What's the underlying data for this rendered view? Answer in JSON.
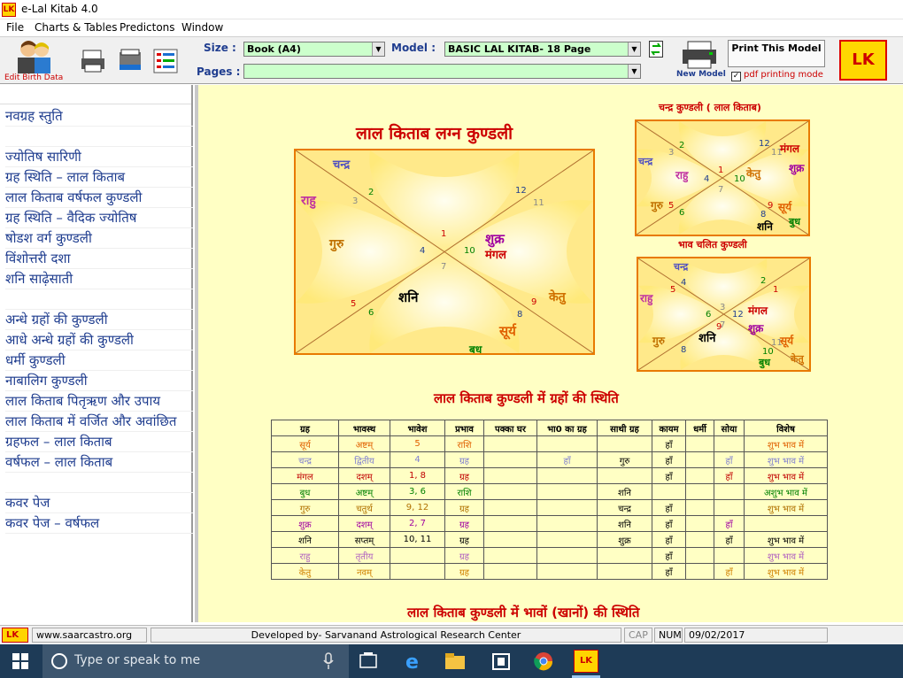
{
  "window": {
    "title": "e-Lal Kitab 4.0",
    "app_icon_text": "LK"
  },
  "menu": [
    "File",
    "Charts & Tables",
    "Predictons",
    "Window"
  ],
  "toolbar": {
    "edit_birth_label": "Edit Birth Data",
    "size_label": "Size :",
    "size_value": "Book (A4)",
    "model_label": "Model :",
    "model_value": "BASIC LAL KITAB- 18 Page",
    "pages_label": "Pages :",
    "pages_value": "",
    "print_label": "Print This Model",
    "new_model_label": "New Model",
    "pdf_label": "pdf printing mode",
    "pdf_checked": "✓",
    "logo_text": "LK"
  },
  "sidebar": {
    "items": [
      "नवग्रह स्तुति",
      "",
      "ज्योतिष सारिणी",
      "ग्रह स्थिति – लाल किताब",
      "लाल किताब वर्षफल कुण्डली",
      "ग्रह स्थिति – वैदिक ज्योतिष",
      "षोडश वर्ग कुण्डली",
      "विंशोत्तरी दशा",
      "शनि साढ़ेसाती",
      "",
      "अन्धे ग्रहों की कुण्डली",
      "आधे अन्धे ग्रहों की कुण्डली",
      "धर्मी कुण्डली",
      "नाबालिग कुण्डली",
      "लाल किताब पितृऋण और उपाय",
      "लाल किताब में वर्जित और अवांछित",
      "ग्रहफल – लाल किताब",
      "वर्षफल – लाल किताब",
      "",
      "कवर पेज",
      "कवर पेज – वर्षफल"
    ]
  },
  "main": {
    "lagna_title": "लाल किताब लग्न कुण्डली",
    "chandra_title": "चन्द्र कुण्डली ( लाल किताब)",
    "bhav_title": "भाव चलित कुण्डली",
    "grah_sthiti_title": "लाल किताब कुण्डली में ग्रहों की स्थिति",
    "bhav_sthiti_title": "लाल किताब कुण्डली में भावों (खानों) की स्थिति"
  },
  "lagna_chart": {
    "planets": {
      "chandra": "चन्द्र",
      "rahu": "राहु",
      "guru": "गुरु",
      "shani": "शनि",
      "shukra": "शुक्र",
      "mangal": "मंगल",
      "ketu": "केतु",
      "surya": "सूर्य",
      "budh": "बुध"
    },
    "houses": [
      "1",
      "2",
      "3",
      "4",
      "5",
      "6",
      "7",
      "8",
      "9",
      "10",
      "11",
      "12"
    ]
  },
  "chandra_chart": {
    "planets": {
      "chandra": "चन्द्र",
      "rahu": "राहु",
      "ketu": "केतु",
      "mangal": "मंगल",
      "shukra": "शुक्र",
      "guru": "गुरु",
      "surya": "सूर्य",
      "shani": "शनि",
      "budh": "बुध"
    },
    "houses": [
      "1",
      "2",
      "3",
      "4",
      "5",
      "6",
      "7",
      "8",
      "9",
      "10",
      "11",
      "12"
    ]
  },
  "bhav_chart": {
    "planets": {
      "chandra": "चन्द्र",
      "rahu": "राहु",
      "mangal": "मंगल",
      "shukra": "शुक्र",
      "guru": "गुरु",
      "shani": "शनि",
      "surya": "सूर्य",
      "budh": "बुध",
      "ketu": "केतु"
    },
    "houses": [
      "1",
      "2",
      "3",
      "4",
      "5",
      "6",
      "7",
      "8",
      "9",
      "10",
      "11",
      "12"
    ]
  },
  "grah_table": {
    "headers": [
      "ग्रह",
      "भावस्थ",
      "भावेश",
      "प्रभाव",
      "पक्का घर",
      "भा0 का ग्रह",
      "साथी ग्रह",
      "कायम",
      "धर्मी",
      "सोया",
      "विशेष"
    ],
    "rows": [
      {
        "color": "#e06000",
        "cells": [
          "सूर्य",
          "अष्टम्",
          "5",
          "राशि",
          "",
          "",
          "",
          "हाँ",
          "",
          "",
          "शुभ भाव में"
        ]
      },
      {
        "color": "#8080d0",
        "cells": [
          "चन्द्र",
          "द्वितीय",
          "4",
          "ग्रह",
          "",
          "हाँ",
          "गुरु",
          "हाँ",
          "",
          "हाँ",
          "शुभ भाव में"
        ]
      },
      {
        "color": "#c00000",
        "cells": [
          "मंगल",
          "दशम्",
          "1, 8",
          "ग्रह",
          "",
          "",
          "",
          "हाँ",
          "",
          "हाँ",
          "शुभ भाव में"
        ]
      },
      {
        "color": "#008000",
        "cells": [
          "बुध",
          "अष्टम्",
          "3, 6",
          "राशि",
          "",
          "",
          "शनि",
          "",
          "",
          "",
          "अशुभ भाव में"
        ]
      },
      {
        "color": "#b07000",
        "cells": [
          "गुरु",
          "चतुर्थ",
          "9, 12",
          "ग्रह",
          "",
          "",
          "चन्द्र",
          "हाँ",
          "",
          "",
          "शुभ भाव में"
        ]
      },
      {
        "color": "#a000a0",
        "cells": [
          "शुक्र",
          "दशम्",
          "2, 7",
          "ग्रह",
          "",
          "",
          "शनि",
          "हाँ",
          "",
          "हाँ",
          ""
        ]
      },
      {
        "color": "#000000",
        "cells": [
          "शनि",
          "सप्तम्",
          "10, 11",
          "ग्रह",
          "",
          "",
          "शुक्र",
          "हाँ",
          "",
          "हाँ",
          "शुभ भाव में"
        ]
      },
      {
        "color": "#b060c0",
        "cells": [
          "राहु",
          "तृतीय",
          "",
          "ग्रह",
          "",
          "",
          "",
          "हाँ",
          "",
          "",
          "शुभ भाव में"
        ]
      },
      {
        "color": "#d08000",
        "cells": [
          "केतु",
          "नवम्",
          "",
          "ग्रह",
          "",
          "",
          "",
          "हाँ",
          "",
          "हाँ",
          "शुभ भाव में"
        ]
      }
    ]
  },
  "status": {
    "website": "www.saarcastro.org",
    "developer": "Developed by- Sarvanand Astrological Research Center",
    "cap": "CAP",
    "num": "NUM",
    "date": "09/02/2017"
  },
  "taskbar": {
    "search_placeholder": "Type or speak to me"
  }
}
